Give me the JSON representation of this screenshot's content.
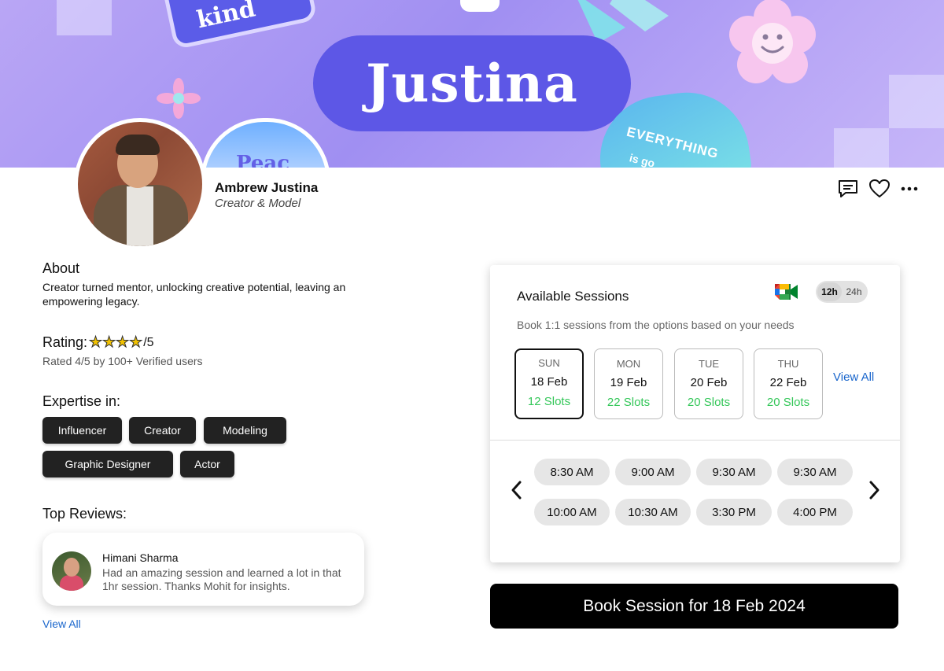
{
  "banner": {
    "name_text": "Justina",
    "colors": {
      "pill": "#5d57e6",
      "background": "#a08ff2"
    }
  },
  "profile": {
    "name": "Ambrew Justina",
    "role": "Creator & Model"
  },
  "header_actions": [
    "chat-icon",
    "heart-icon",
    "more-icon"
  ],
  "about": {
    "title": "About",
    "text": "Creator turned mentor, unlocking creative potential, leaving an empowering legacy."
  },
  "rating": {
    "label": "Rating:",
    "stars": "★★★★",
    "max": "/5",
    "value": 4,
    "note": "Rated 4/5 by 100+ Verified users"
  },
  "expertise": {
    "title": "Expertise in:",
    "chips": [
      "Influencer",
      "Creator",
      "Modeling",
      "Graphic Designer",
      "Actor"
    ]
  },
  "reviews": {
    "title": "Top Reviews:",
    "items": [
      {
        "name": "Himani Sharma",
        "text": "Had an amazing session and learned a lot in that 1hr session. Thanks Mohit for insights."
      }
    ],
    "view_all": "View All"
  },
  "sessions": {
    "title": "Available Sessions",
    "subtitle": "Book 1:1 sessions from the options based on your needs",
    "toggle": {
      "option_12h": "12h",
      "option_24h": "24h",
      "selected": "12h"
    },
    "days": [
      {
        "weekday": "SUN",
        "date": "18 Feb",
        "slots": "12 Slots",
        "selected": true
      },
      {
        "weekday": "MON",
        "date": "19 Feb",
        "slots": "22 Slots",
        "selected": false
      },
      {
        "weekday": "TUE",
        "date": "20 Feb",
        "slots": "20 Slots",
        "selected": false
      },
      {
        "weekday": "THU",
        "date": "22 Feb",
        "slots": "20 Slots",
        "selected": false
      }
    ],
    "view_all": "View All",
    "times": [
      "8:30 AM",
      "9:00 AM",
      "9:30 AM",
      "9:30 AM",
      "10:00 AM",
      "10:30 AM",
      "3:30 PM",
      "4:00 PM"
    ],
    "slot_color": "#34c759"
  },
  "book_button": "Book Session for 18 Feb 2024"
}
